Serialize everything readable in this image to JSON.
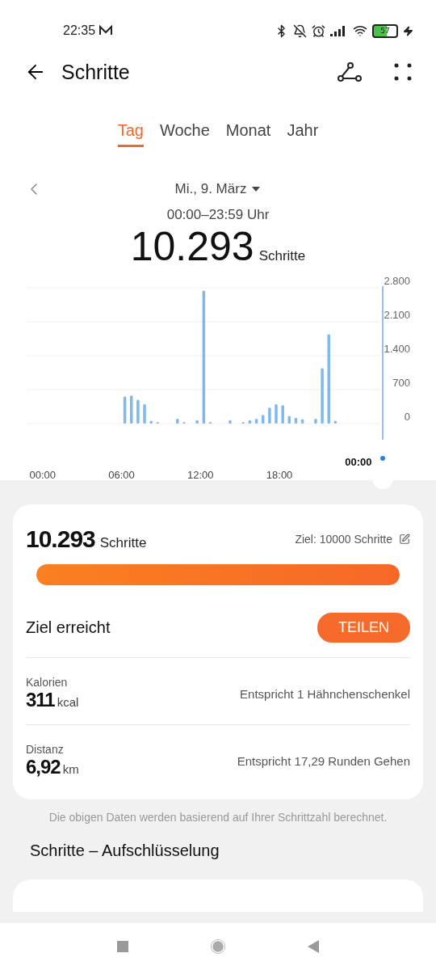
{
  "status_bar": {
    "time": "22:35",
    "battery": "57"
  },
  "header": {
    "title": "Schritte"
  },
  "tabs": [
    {
      "label": "Tag",
      "selected": true
    },
    {
      "label": "Woche",
      "selected": false
    },
    {
      "label": "Monat",
      "selected": false
    },
    {
      "label": "Jahr",
      "selected": false
    }
  ],
  "date_nav": {
    "date": "Mi., 9. März",
    "time_range": "00:00–23:59 Uhr"
  },
  "total": {
    "value": "10.293",
    "unit": "Schritte"
  },
  "chart": {
    "cursor_label": "00:00",
    "chart_data": {
      "type": "bar",
      "grid": true,
      "xlim": [
        -1.2,
        25.6
      ],
      "x": [
        6.25,
        6.75,
        7.25,
        7.75,
        8.25,
        8.75,
        10.25,
        10.75,
        11.75,
        12.25,
        12.75,
        14.25,
        15.25,
        15.75,
        16.25,
        16.75,
        17.25,
        17.75,
        18.25,
        18.75,
        19.25,
        19.75,
        20.75,
        21.25,
        21.75,
        22.25
      ],
      "series": [
        {
          "color": "#7fb8ec",
          "values": [
            560,
            580,
            490,
            400,
            60,
            30,
            100,
            30,
            70,
            2740,
            30,
            70,
            30,
            70,
            100,
            180,
            330,
            400,
            380,
            160,
            120,
            90,
            100,
            1140,
            1840,
            60
          ]
        }
      ],
      "ylim": [
        0,
        2800
      ],
      "xticks": [
        {
          "value": 0,
          "label": "00:00"
        },
        {
          "value": 6,
          "label": "06:00"
        },
        {
          "value": 12,
          "label": "12:00"
        },
        {
          "value": 18,
          "label": "18:00"
        }
      ],
      "yticks": [
        {
          "value": 0,
          "label": "0"
        },
        {
          "value": 700,
          "label": "700"
        },
        {
          "value": 1400,
          "label": "1.400"
        },
        {
          "value": 2100,
          "label": "2.100"
        },
        {
          "value": 2800,
          "label": "2.800"
        }
      ]
    }
  },
  "summary": {
    "value": "10.293",
    "unit": "Schritte",
    "goal": "Ziel: 10000 Schritte",
    "level": 1,
    "goal_status": "Ziel erreicht",
    "share_button": "TEILEN"
  },
  "stats": [
    {
      "label": "Kalorien",
      "value": "311",
      "unit": "kcal",
      "equivalent": "Entspricht 1 Hähnchenschenkel"
    },
    {
      "label": "Distanz",
      "value": "6,92",
      "unit": "km",
      "equivalent": "Entspricht 17,29 Runden Gehen"
    }
  ],
  "note": "Die obigen Daten werden basierend auf Ihrer Schrittzahl berechnet.",
  "section_title": "Schritte – Aufschlüsselung"
}
